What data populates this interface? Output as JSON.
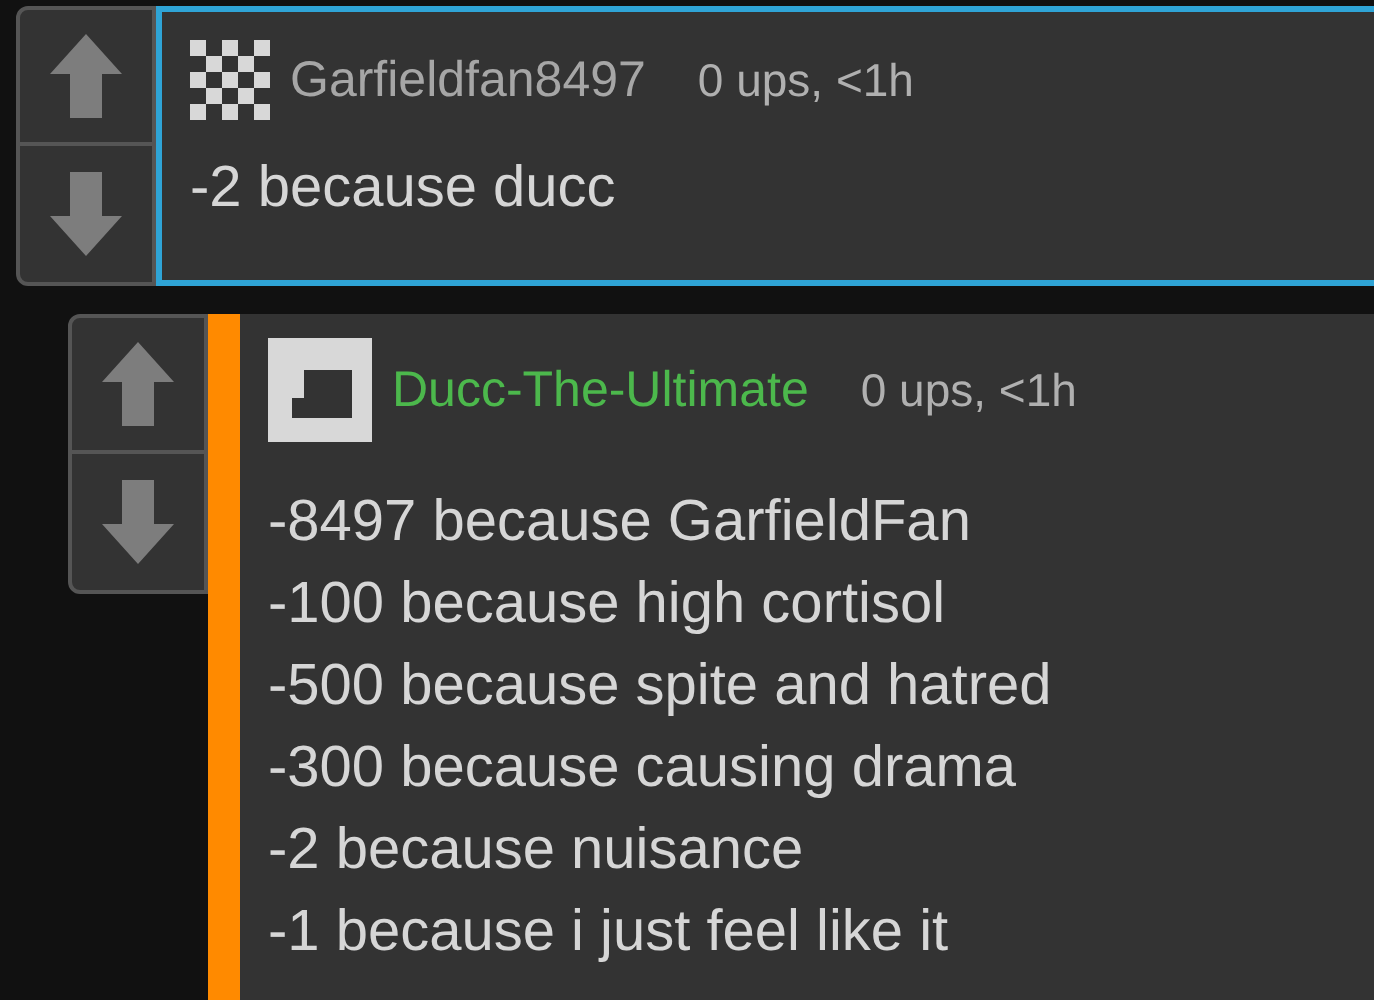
{
  "comments": [
    {
      "kind": "focused",
      "avatar": {
        "kind": "checker"
      },
      "author": "Garfieldfan8497",
      "color": "#a6a6a6",
      "meta": "0 ups, <1h",
      "lines": [
        "-2 because ducc"
      ]
    },
    {
      "kind": "reply",
      "avatar": {
        "kind": "block"
      },
      "author": "Ducc-The-Ultimate",
      "color": "#4cb84c",
      "meta": "0 ups, <1h",
      "lines": [
        "-8497 because GarfieldFan",
        "-100 because high cortisol",
        "-500 because spite and hatred",
        "-300 because causing drama",
        "-2 because nuisance",
        "-1 because i just feel like it"
      ]
    }
  ]
}
